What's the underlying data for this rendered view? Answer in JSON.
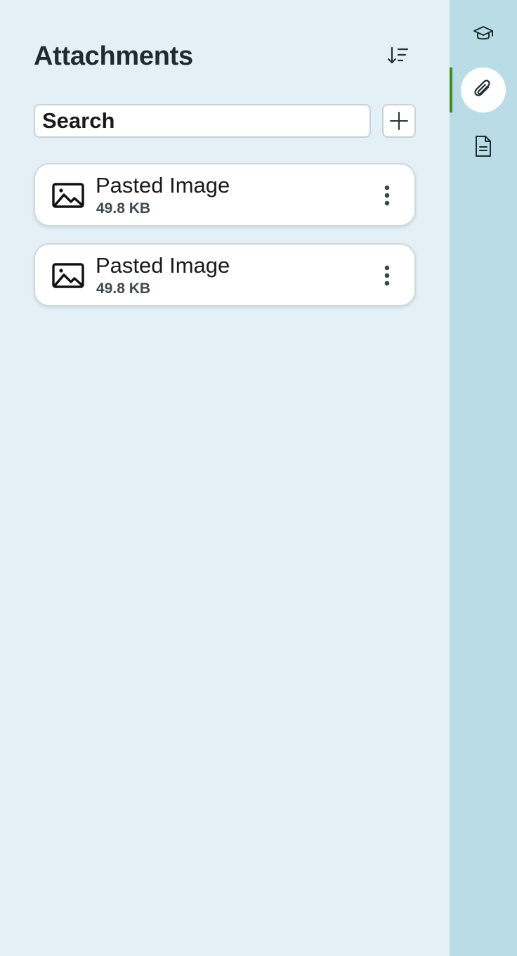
{
  "panel": {
    "title": "Attachments",
    "search": {
      "placeholder": "Search",
      "value": ""
    },
    "sort_icon": "sort-descending-icon",
    "add_icon": "plus-icon"
  },
  "attachments": [
    {
      "name": "Pasted Image",
      "size": "49.8 KB",
      "icon": "image-icon"
    },
    {
      "name": "Pasted Image",
      "size": "49.8 KB",
      "icon": "image-icon"
    }
  ],
  "rail": {
    "items": [
      {
        "icon": "graduation-cap-icon",
        "active": false
      },
      {
        "icon": "paperclip-icon",
        "active": true
      },
      {
        "icon": "document-icon",
        "active": false
      }
    ],
    "accent_color": "#3e8d1f"
  }
}
